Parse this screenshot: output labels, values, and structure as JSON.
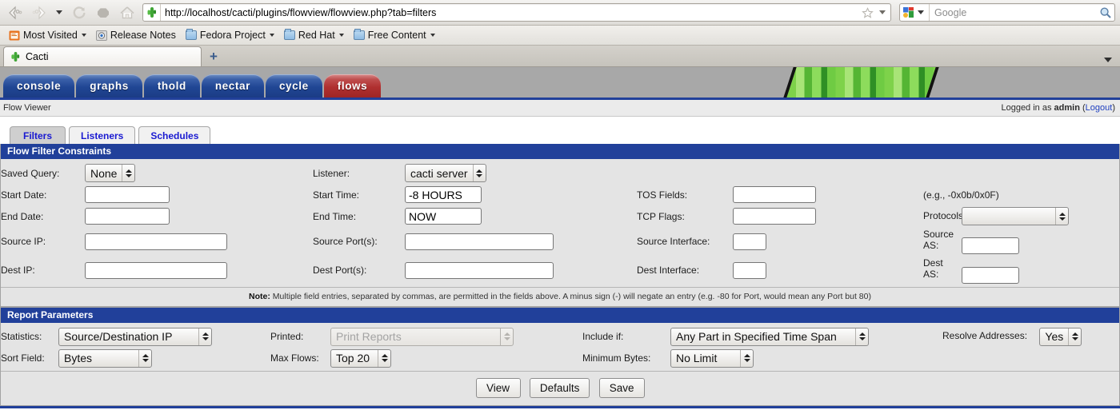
{
  "browser": {
    "back_icon": "back-arrow-icon",
    "forward_icon": "forward-arrow-icon",
    "history_dropdown_icon": "chevron-down-icon",
    "reload_icon": "reload-icon",
    "stop_icon": "stop-icon",
    "home_icon": "home-icon",
    "url": "http://localhost/cacti/plugins/flowview/flowview.php?tab=filters",
    "url_favicon": "cacti-favicon",
    "bookmark_star_icon": "star-icon",
    "search_engine_icon": "google-icon",
    "search_placeholder": "Google",
    "search_go_icon": "search-icon",
    "bookmarks": [
      {
        "label": "Most Visited",
        "icon": "most-visited-icon",
        "has_caret": true
      },
      {
        "label": "Release Notes",
        "icon": "release-notes-icon",
        "has_caret": false
      },
      {
        "label": "Fedora Project",
        "icon": "folder-icon",
        "has_caret": true
      },
      {
        "label": "Red Hat",
        "icon": "folder-icon",
        "has_caret": true
      },
      {
        "label": "Free Content",
        "icon": "folder-icon",
        "has_caret": true
      }
    ],
    "tab_title": "Cacti",
    "tab_favicon": "cacti-favicon",
    "new_tab_label": "+",
    "tablist_caret_icon": "chevron-down-icon"
  },
  "cacti_nav": {
    "tabs": [
      {
        "label": "console",
        "active": false
      },
      {
        "label": "graphs",
        "active": false
      },
      {
        "label": "thold",
        "active": false
      },
      {
        "label": "nectar",
        "active": false
      },
      {
        "label": "cycle",
        "active": false
      },
      {
        "label": "flows",
        "active": true
      }
    ],
    "accent_blue": "#21409a",
    "accent_red": "#b03030"
  },
  "page_header": {
    "title": "Flow Viewer",
    "login_prefix": "Logged in as",
    "user": "admin",
    "logout_open": "(",
    "logout_label": "Logout",
    "logout_close": ")"
  },
  "subtabs": [
    {
      "label": "Filters",
      "active": true
    },
    {
      "label": "Listeners",
      "active": false
    },
    {
      "label": "Schedules",
      "active": false
    }
  ],
  "filters_panel": {
    "title": "Flow Filter Constraints",
    "saved_query": {
      "label": "Saved Query:",
      "value": "None"
    },
    "start_date": {
      "label": "Start Date:",
      "value": ""
    },
    "end_date": {
      "label": "End Date:",
      "value": ""
    },
    "source_ip": {
      "label": "Source IP:",
      "value": ""
    },
    "dest_ip": {
      "label": "Dest IP:",
      "value": ""
    },
    "listener": {
      "label": "Listener:",
      "value": "cacti server"
    },
    "start_time": {
      "label": "Start Time:",
      "value": "-8 HOURS"
    },
    "end_time": {
      "label": "End Time:",
      "value": "NOW"
    },
    "source_ports": {
      "label": "Source Port(s):",
      "value": ""
    },
    "dest_ports": {
      "label": "Dest Port(s):",
      "value": ""
    },
    "tos_fields": {
      "label": "TOS Fields:",
      "value": ""
    },
    "tcp_flags": {
      "label": "TCP Flags:",
      "value": ""
    },
    "source_interface": {
      "label": "Source Interface:",
      "value": ""
    },
    "dest_interface": {
      "label": "Dest Interface:",
      "value": ""
    },
    "tos_hint": "(e.g., -0x0b/0x0F)",
    "protocols": {
      "label": "Protocols:",
      "value": ""
    },
    "source_as": {
      "label": "Source AS:",
      "value": ""
    },
    "dest_as": {
      "label": "Dest AS:",
      "value": ""
    },
    "note_bold": "Note:",
    "note_text": " Multiple field entries, separated by commas, are permitted in the fields above. A minus sign (-) will negate an entry (e.g. -80 for Port, would mean any Port but 80)"
  },
  "report_panel": {
    "title": "Report Parameters",
    "statistics": {
      "label": "Statistics:",
      "value": "Source/Destination IP"
    },
    "sort_field": {
      "label": "Sort Field:",
      "value": "Bytes"
    },
    "printed": {
      "label": "Printed:",
      "value": "Print Reports",
      "disabled": true
    },
    "max_flows": {
      "label": "Max Flows:",
      "value": "Top 20"
    },
    "include_if": {
      "label": "Include if:",
      "value": "Any Part in Specified Time Span"
    },
    "minimum_bytes": {
      "label": "Minimum Bytes:",
      "value": "No Limit"
    },
    "resolve_addresses": {
      "label": "Resolve Addresses:",
      "value": "Yes"
    }
  },
  "buttons": {
    "view": "View",
    "defaults": "Defaults",
    "save": "Save"
  }
}
